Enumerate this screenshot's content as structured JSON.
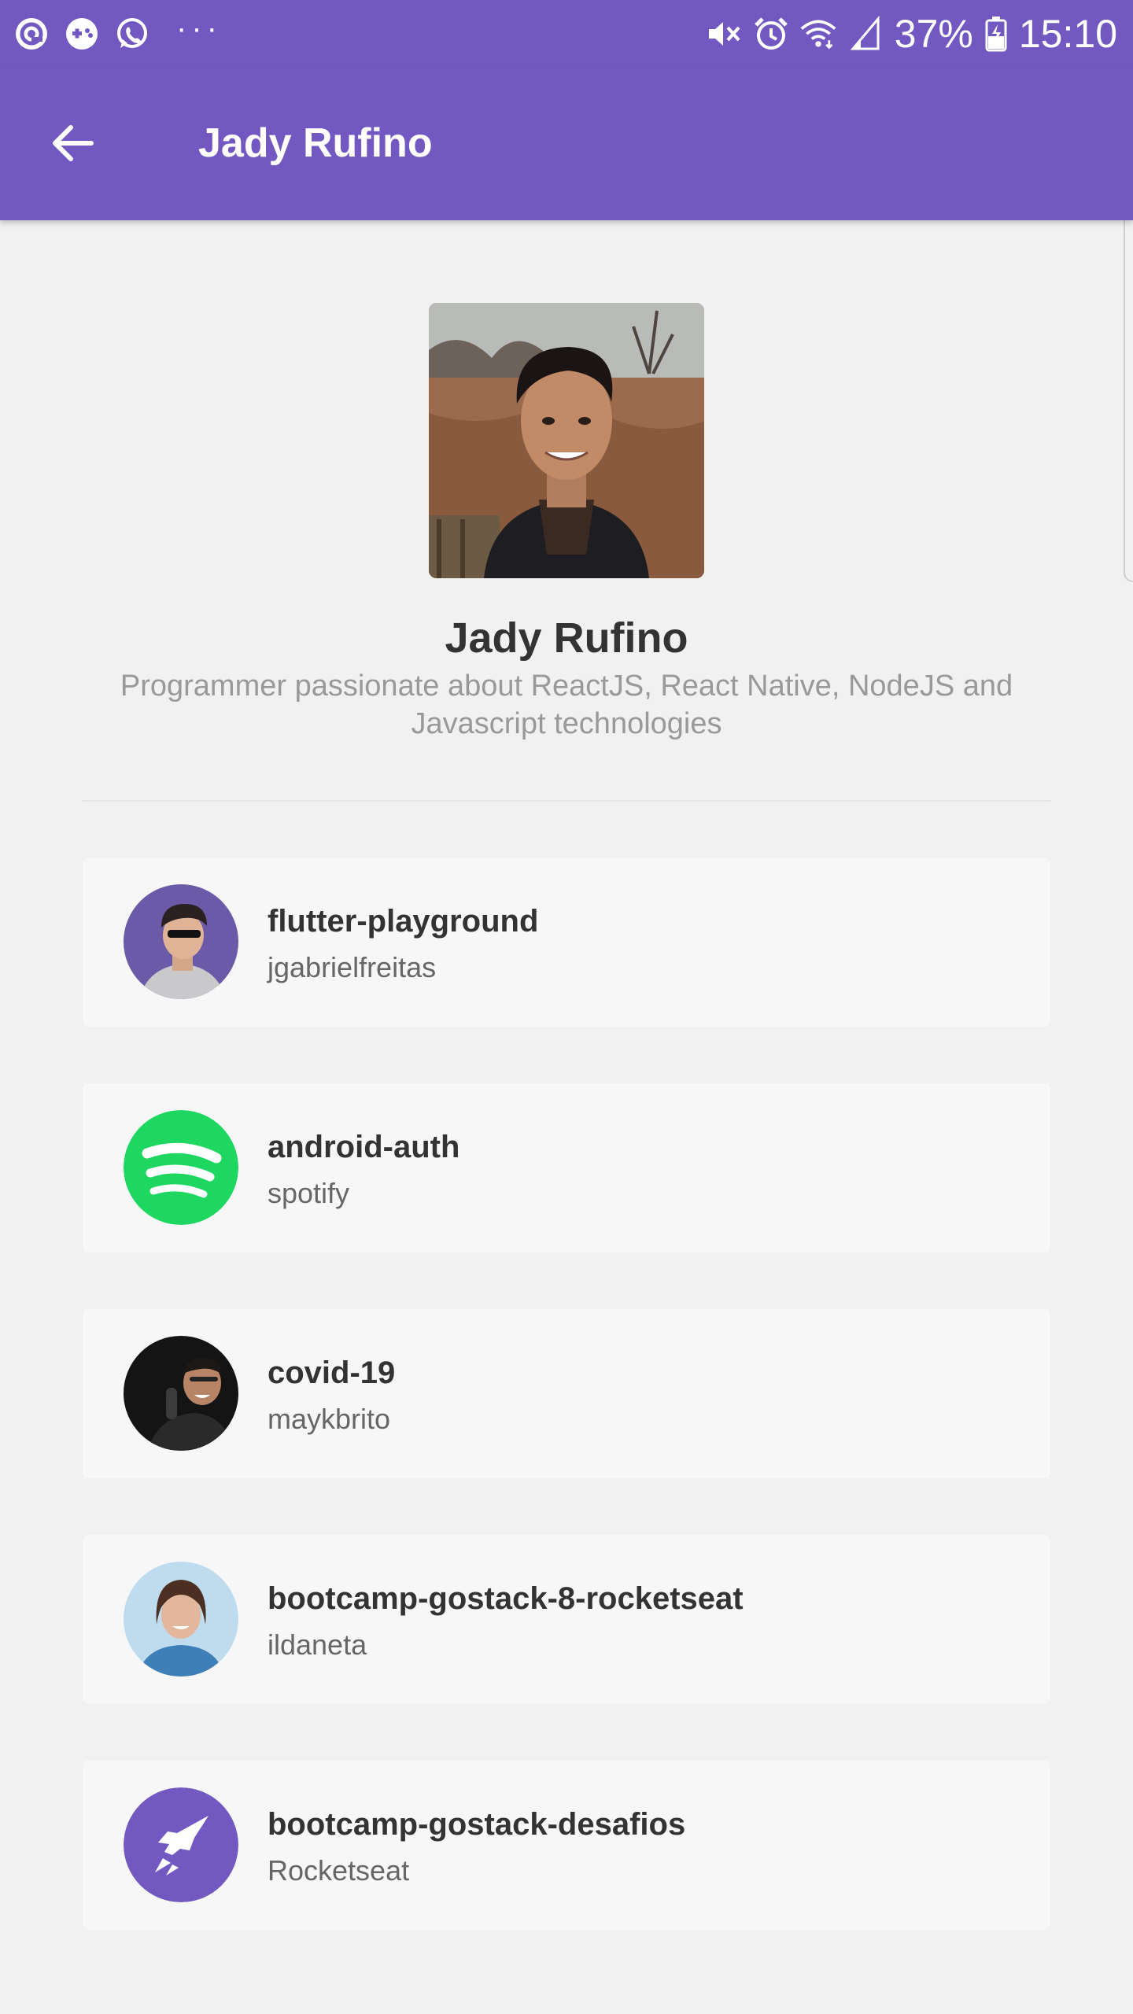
{
  "status_bar": {
    "battery": "37%",
    "time": "15:10",
    "left_icons": [
      "at-sign-icon",
      "gamepad-icon",
      "whatsapp-icon",
      "more-dots-icon"
    ],
    "right_icons": [
      "mute-icon",
      "alarm-icon",
      "wifi-icon",
      "signal-icon",
      "battery-charging-icon"
    ]
  },
  "app_bar": {
    "title": "Jady Rufino",
    "back_icon": "arrow-back-icon"
  },
  "profile": {
    "name": "Jady Rufino",
    "bio": "Programmer passionate about ReactJS, React Native, NodeJS and Javascript technologies"
  },
  "repos": [
    {
      "name": "flutter-playground",
      "owner": "jgabrielfreitas"
    },
    {
      "name": "android-auth",
      "owner": "spotify"
    },
    {
      "name": "covid-19",
      "owner": "maykbrito"
    },
    {
      "name": "bootcamp-gostack-8-rocketseat",
      "owner": "ildaneta"
    },
    {
      "name": "bootcamp-gostack-desafios",
      "owner": "Rocketseat"
    }
  ],
  "colors": {
    "primary": "#7159c1",
    "background": "#f1f1f2",
    "card": "#f7f7f8",
    "title_text": "#333333",
    "bio_text": "#999999",
    "owner_text": "#666666",
    "spotify_green": "#1ed760"
  }
}
